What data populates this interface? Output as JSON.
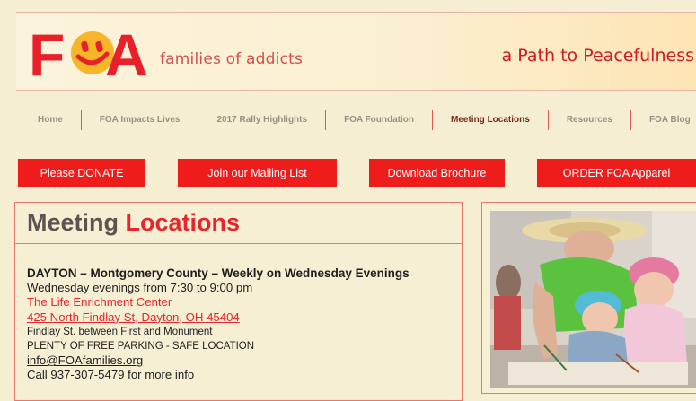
{
  "header": {
    "logo_letter_f": "F",
    "logo_letter_a": "A",
    "logo_subtitle": "families of addicts",
    "tagline": "a Path to Peacefulness",
    "logo_face_color": "#f7b529",
    "brand_red": "#e8202a"
  },
  "nav": {
    "items": [
      {
        "label": "Home"
      },
      {
        "label": "FOA Impacts Lives"
      },
      {
        "label": "2017 Rally Highlights"
      },
      {
        "label": "FOA Foundation"
      },
      {
        "label": "Meeting Locations"
      },
      {
        "label": "Resources"
      },
      {
        "label": "FOA Blog"
      }
    ],
    "active": "Meeting Locations"
  },
  "buttons": {
    "donate": "Please DONATE",
    "mailing": "Join our Mailing List",
    "brochure": "Download Brochure",
    "apparel": "ORDER FOA Apparel"
  },
  "content": {
    "title_part1": "Meeting",
    "title_part2": "Locations",
    "location": {
      "heading": "DAYTON – Montgomery County – Weekly on Wednesday Evenings",
      "schedule": "Wednesday evenings from 7:30 to 9:00 pm",
      "venue": "The Life Enrichment Center",
      "address": "425 North Findlay St, Dayton, OH 45404",
      "cross_streets": "Findlay St. between First and Monument",
      "parking": "PLENTY OF FREE PARKING - SAFE LOCATION",
      "email": "info@FOAfamilies.org",
      "phone": "Call 937-307-5479 for more info"
    }
  },
  "photo": {
    "icon": "photo-children-drawing"
  }
}
